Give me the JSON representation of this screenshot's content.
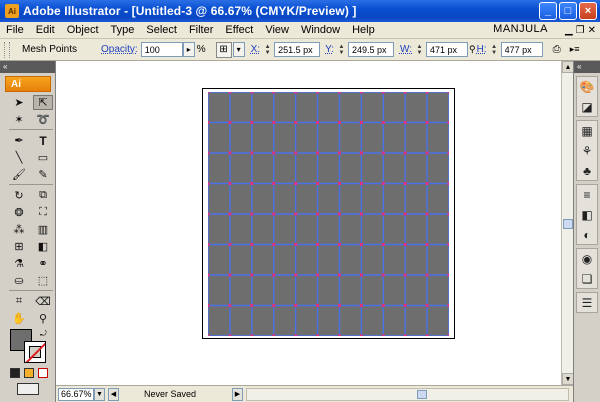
{
  "window": {
    "app_icon": "Ai",
    "title": "Adobe Illustrator - [Untitled-3 @ 66.67% (CMYK/Preview) ]",
    "minimize": "_",
    "maximize": "□",
    "close": "×"
  },
  "menu": {
    "items": [
      "File",
      "Edit",
      "Object",
      "Type",
      "Select",
      "Filter",
      "Effect",
      "View",
      "Window",
      "Help"
    ],
    "user": "MANJULA"
  },
  "control": {
    "tool_name": "Mesh Points",
    "opacity_label": "Opacity:",
    "opacity_value": "100",
    "opacity_unit": "%",
    "x_label": "X:",
    "x_value": "251.5 px",
    "y_label": "Y:",
    "y_value": "249.5 px",
    "w_label": "W:",
    "w_value": "471 px",
    "h_label": "H:",
    "h_value": "477 px"
  },
  "tools_panel": {
    "badge": "Ai",
    "collapse": "«"
  },
  "status": {
    "zoom": "66.67%",
    "status_text": "Never Saved"
  },
  "artwork": {
    "fill_color": "#6e6e6e",
    "mesh_line_color": "#4a72e8",
    "mesh_point_color": "#e0307a"
  }
}
